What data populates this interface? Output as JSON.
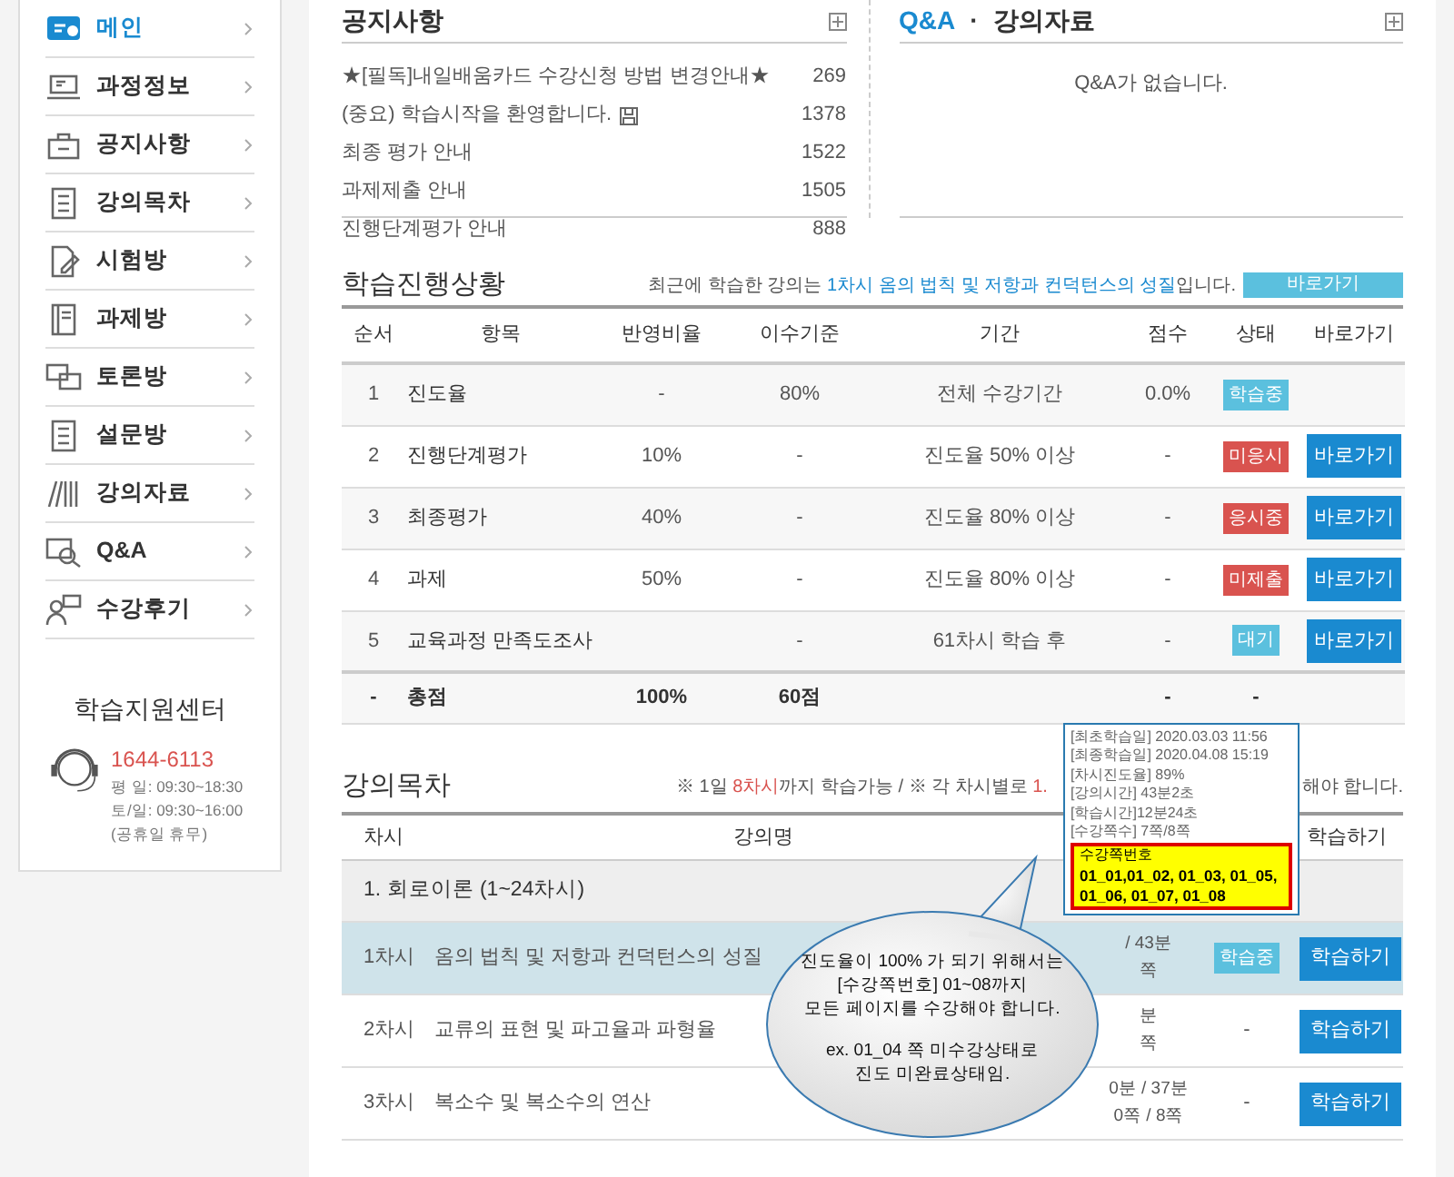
{
  "sidebar": {
    "items": [
      {
        "label": "메인",
        "selected": true
      },
      {
        "label": "과정정보",
        "selected": false
      },
      {
        "label": "공지사항",
        "selected": false
      },
      {
        "label": "강의목차",
        "selected": false
      },
      {
        "label": "시험방",
        "selected": false
      },
      {
        "label": "과제방",
        "selected": false
      },
      {
        "label": "토론방",
        "selected": false
      },
      {
        "label": "설문방",
        "selected": false
      },
      {
        "label": "강의자료",
        "selected": false
      },
      {
        "label": "Q&A",
        "selected": false
      },
      {
        "label": "수강후기",
        "selected": false
      }
    ]
  },
  "support": {
    "title": "학습지원센터",
    "phone": "1644-6113",
    "hours": [
      "평 일: 09:30~18:30",
      "토/일: 09:30~16:00",
      "(공휴일 휴무)"
    ]
  },
  "notices": {
    "title": "공지사항",
    "items": [
      {
        "title": "★[필독]내일배움카드 수강신청 방법 변경안내★",
        "count": "269",
        "attachment": false
      },
      {
        "title": "(중요) 학습시작을 환영합니다.",
        "count": "1378",
        "attachment": true
      },
      {
        "title": "최종 평가 안내",
        "count": "1522",
        "attachment": false
      },
      {
        "title": "과제제출 안내",
        "count": "1505",
        "attachment": false
      },
      {
        "title": "진행단계평가 안내",
        "count": "888",
        "attachment": false
      }
    ]
  },
  "qna": {
    "tabs": [
      {
        "label": "Q&A",
        "selected": true
      },
      {
        "label": "강의자료",
        "selected": false
      }
    ],
    "separator": "·",
    "empty": "Q&A가 없습니다."
  },
  "progress": {
    "title": "학습진행상황",
    "recent_prefix": "최근에 학습한 강의는 ",
    "recent_link": "1차시 옴의 법칙 및 저항과 컨덕턴스의 성질",
    "recent_suffix": "입니다.",
    "recent_button": "바로가기",
    "columns": [
      "순서",
      "항목",
      "반영비율",
      "이수기준",
      "기간",
      "점수",
      "상태",
      "바로가기"
    ],
    "rows": [
      {
        "order": "1",
        "item": "진도율",
        "ratio": "-",
        "criteria": "80%",
        "period": "전체 수강기간",
        "score": "0.0%",
        "status": {
          "label": "학습중",
          "color": "#5bc0de"
        }
      },
      {
        "order": "2",
        "item": "진행단계평가",
        "ratio": "10%",
        "criteria": "-",
        "period": "진도율 50% 이상",
        "score": "-",
        "status": {
          "label": "미응시",
          "color": "#d9534f"
        },
        "button": "바로가기"
      },
      {
        "order": "3",
        "item": "최종평가",
        "ratio": "40%",
        "criteria": "-",
        "period": "진도율 80% 이상",
        "score": "-",
        "status": {
          "label": "응시중",
          "color": "#d9534f"
        },
        "button": "바로가기"
      },
      {
        "order": "4",
        "item": "과제",
        "ratio": "50%",
        "criteria": "-",
        "period": "진도율 80% 이상",
        "score": "-",
        "status": {
          "label": "미제출",
          "color": "#d9534f"
        },
        "button": "바로가기"
      },
      {
        "order": "5",
        "item": "교육과정 만족도조사",
        "criteria": "-",
        "period": "61차시 학습 후",
        "score": "-",
        "status": {
          "label": "대기",
          "color": "#5bc0de"
        },
        "button": "바로가기"
      }
    ],
    "total": {
      "order": "-",
      "item": "총점",
      "ratio": "100%",
      "criteria": "60점",
      "score": "-",
      "status": "-"
    }
  },
  "lectures": {
    "title": "강의목차",
    "notice_left": [
      {
        "text": "※ 1일 ",
        "red": false
      },
      {
        "text": "8차시",
        "red": true
      },
      {
        "text": "까지 학습가능 / ※ 각 차시별로 ",
        "red": false
      },
      {
        "text": "1.",
        "red": true
      }
    ],
    "notice_right": "해야 합니다.",
    "columns": [
      "차시",
      "강의명",
      "학습하기"
    ],
    "group": "1. 회로이론 (1~24차시)",
    "rows": [
      {
        "no": "1차시",
        "name": "옴의 법칙 및 저항과 컨덕턴스의 성질",
        "time": "/ 43분",
        "pages": "쪽",
        "status": {
          "kind": "badge",
          "label": "학습중"
        },
        "button": "학습하기",
        "selected": true
      },
      {
        "no": "2차시",
        "name": "교류의 표현 및 파고율과 파형율",
        "time": "분",
        "pages": "쪽",
        "status": {
          "kind": "text",
          "label": "-"
        },
        "button": "학습하기",
        "selected": false
      },
      {
        "no": "3차시",
        "name": "복소수 및 복소수의 연산",
        "time": "0분 / 37분",
        "pages": "0쪽 / 8쪽",
        "status": {
          "kind": "text",
          "label": "-"
        },
        "button": "학습하기",
        "selected": false
      }
    ]
  },
  "tooltip": {
    "lines": [
      "[최초학습일] 2020.03.03 11:56",
      "[최종학습일] 2020.04.08 15:19",
      "[차시진도율] 89%",
      "[강의시간] 43분2초",
      "[학습시간]12분24초",
      "[수강쪽수] 7쪽/8쪽"
    ],
    "highlight_label": "수강쪽번호",
    "highlight_value": "01_01,01_02, 01_03, 01_05, 01_06, 01_07, 01_08"
  },
  "bubble": {
    "paragraphs": [
      [
        "진도율이 100% 가 되기 위해서는",
        "[수강쪽번호] 01~08까지",
        "모든 페이지를 수강해야 합니다."
      ],
      [
        "ex. 01_04 쪽 미수강상태로",
        "진도 미완료상태임."
      ]
    ]
  }
}
